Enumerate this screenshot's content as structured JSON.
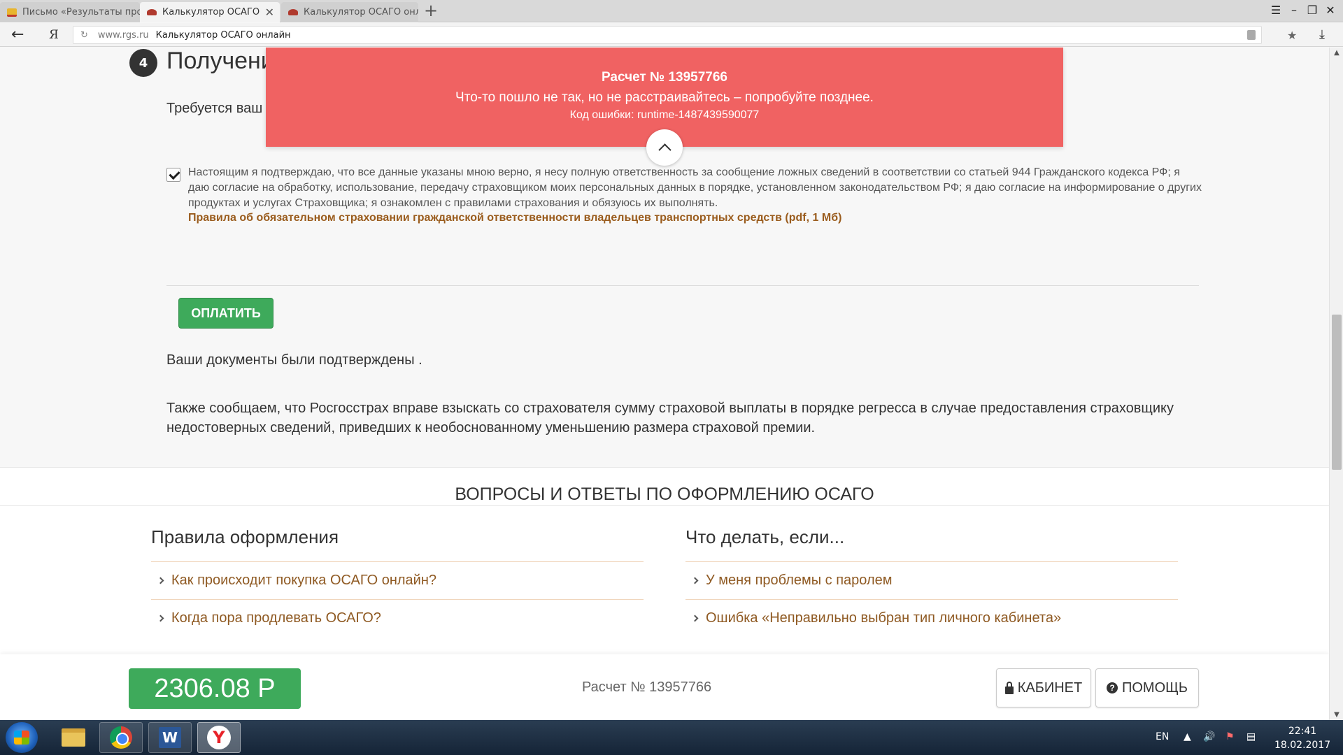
{
  "browser": {
    "tabs": [
      {
        "title": "Письмо «Результаты прове",
        "state": "inactive"
      },
      {
        "title": "Калькулятор ОСАГО онлайн",
        "state": "active"
      },
      {
        "title": "Калькулятор ОСАГО онлайн",
        "state": "inactive"
      }
    ],
    "new_tab": "+",
    "yandex_button": "Я",
    "address": {
      "domain": "www.rgs.ru",
      "page_title": "Калькулятор ОСАГО онлайн"
    }
  },
  "step": {
    "number": "4",
    "title": "Получени",
    "required_text": "Требуется ваш"
  },
  "error_banner": {
    "title": "Расчет № 13957766",
    "message": "Что-то пошло не так, но не расстраивайтесь – попробуйте позднее.",
    "code": "Код ошибки: runtime-1487439590077",
    "color": "#f06262"
  },
  "consent": {
    "checked": true,
    "text": "Настоящим я подтверждаю, что все данные указаны мною верно, я несу полную ответственность за сообщение ложных сведений в соответствии со статьей 944 Гражданского кодекса РФ; я даю согласие на обработку, использование, передачу страховщиком моих персональных данных в порядке, установленном законодательством РФ; я даю согласие на информирование о других продуктах и услугах Страховщика; я ознакомлен с правилами страхования и обязуюсь их выполнять.",
    "rules_link": "Правила об обязательном страховании гражданской ответственности владельцев транспортных средств (pdf, 1 Мб)"
  },
  "pay_button": "ОПЛАТИТЬ",
  "docs_confirmed": "Ваши документы были подтверждены .",
  "regress_text": "Также сообщаем, что Росгосстрах вправе взыскать со страхователя сумму страховой выплаты в порядке регресса в случае предоставления страховщику недостоверных сведений, приведших к необоснованному уменьшению размера страховой премии.",
  "faq": {
    "heading": "ВОПРОСЫ И ОТВЕТЫ ПО ОФОРМЛЕНИЮ ОСАГО",
    "left": {
      "title": "Правила оформления",
      "items": [
        "Как происходит покупка ОСАГО онлайн?",
        "Когда пора продлевать ОСАГО?"
      ]
    },
    "right": {
      "title": "Что делать, если...",
      "items": [
        "У меня проблемы с паролем",
        "Ошибка «Неправильно выбран тип личного кабинета»"
      ]
    }
  },
  "bottom_bar": {
    "price": "2306.08  Р",
    "calc_number": "Расчет № 13957766",
    "cabinet_button": "КАБИНЕТ",
    "help_button": "ПОМОЩЬ"
  },
  "taskbar": {
    "apps": [
      "start-button",
      "file-explorer",
      "chrome",
      "word",
      "yandex-browser"
    ],
    "language": "EN",
    "time": "22:41",
    "date": "18.02.2017"
  },
  "colors": {
    "accent_green": "#3eaa5b",
    "link_brown": "#8f5a23",
    "error_red": "#f06262"
  }
}
